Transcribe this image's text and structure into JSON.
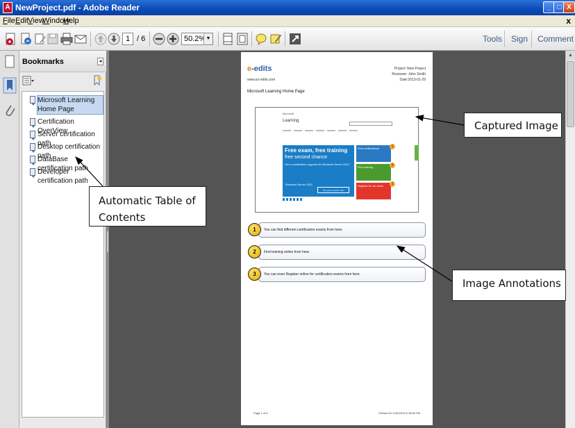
{
  "window": {
    "title": "NewProject.pdf - Adobe Reader",
    "app_icon_glyph": "A",
    "buttons": {
      "minimize": "_",
      "maximize": "□",
      "close": "X"
    }
  },
  "menu": {
    "items": [
      "File",
      "Edit",
      "View",
      "Window",
      "Help"
    ],
    "close_doc": "x"
  },
  "toolbar": {
    "current_page": "1",
    "page_total": "/ 6",
    "zoom": "50.2%",
    "zoom_drop": "▼",
    "right": [
      "Tools",
      "Sign",
      "Comment"
    ],
    "icons": [
      "create-pdf-icon",
      "open-icon",
      "edit-icon",
      "save-icon",
      "print-icon",
      "email-icon",
      "prev-page-icon",
      "next-page-icon",
      "zoom-out-icon",
      "zoom-in-icon",
      "fit-page-icon",
      "fit-width-icon",
      "sticky-note-icon",
      "highlight-icon",
      "full-screen-icon"
    ]
  },
  "bookmarks": {
    "title": "Bookmarks",
    "collapse": "◂",
    "items": [
      {
        "label": "Microsoft Learning Home Page",
        "selected": true
      },
      {
        "label": "Certification OverView"
      },
      {
        "label": "Server certification path"
      },
      {
        "label": "Desktop certification path"
      },
      {
        "label": "DataBase certification path"
      },
      {
        "label": "Developer certification path"
      }
    ]
  },
  "page": {
    "logo_main": "e",
    "logo_rest": "-edits",
    "url": "www.ez-edits.com",
    "meta": [
      "Project: New Project",
      "Reviewer: John Smith",
      "Date:2013-01-29"
    ],
    "heading": "Microsoft Learning Home Page",
    "screenshot": {
      "ms_logo": "Microsoft",
      "learning": "Learning",
      "hero_title": "Free exam, free training",
      "hero_title2": "free second chance",
      "hero_sub": "Get a certification upgrade for Windows Server 2012",
      "hero_ws": "Windows Server 2012",
      "hero_cta": "Get your voucher now",
      "tiles": [
        {
          "label": "Find certifications",
          "color": "#2b79c2",
          "badge": "1"
        },
        {
          "label": "Find training",
          "color": "#4b9a2f",
          "badge": "2"
        },
        {
          "label": "Register for an exam",
          "color": "#e2362b",
          "badge": "3"
        }
      ]
    },
    "annotations": [
      {
        "num": "1",
        "text": "You can find different certification exams from here."
      },
      {
        "num": "2",
        "text": "Find training online from here."
      },
      {
        "num": "3",
        "text": "You can even Register online for certification exams from here."
      }
    ],
    "footer_left": "Page 1 of 6",
    "footer_right": "Printed On 1/29/2013 6:18:55 PM"
  },
  "callouts": {
    "captured_image": "Captured Image",
    "toc_line1": "Automatic Table of",
    "toc_line2": "Contents",
    "annotations": "Image Annotations"
  }
}
